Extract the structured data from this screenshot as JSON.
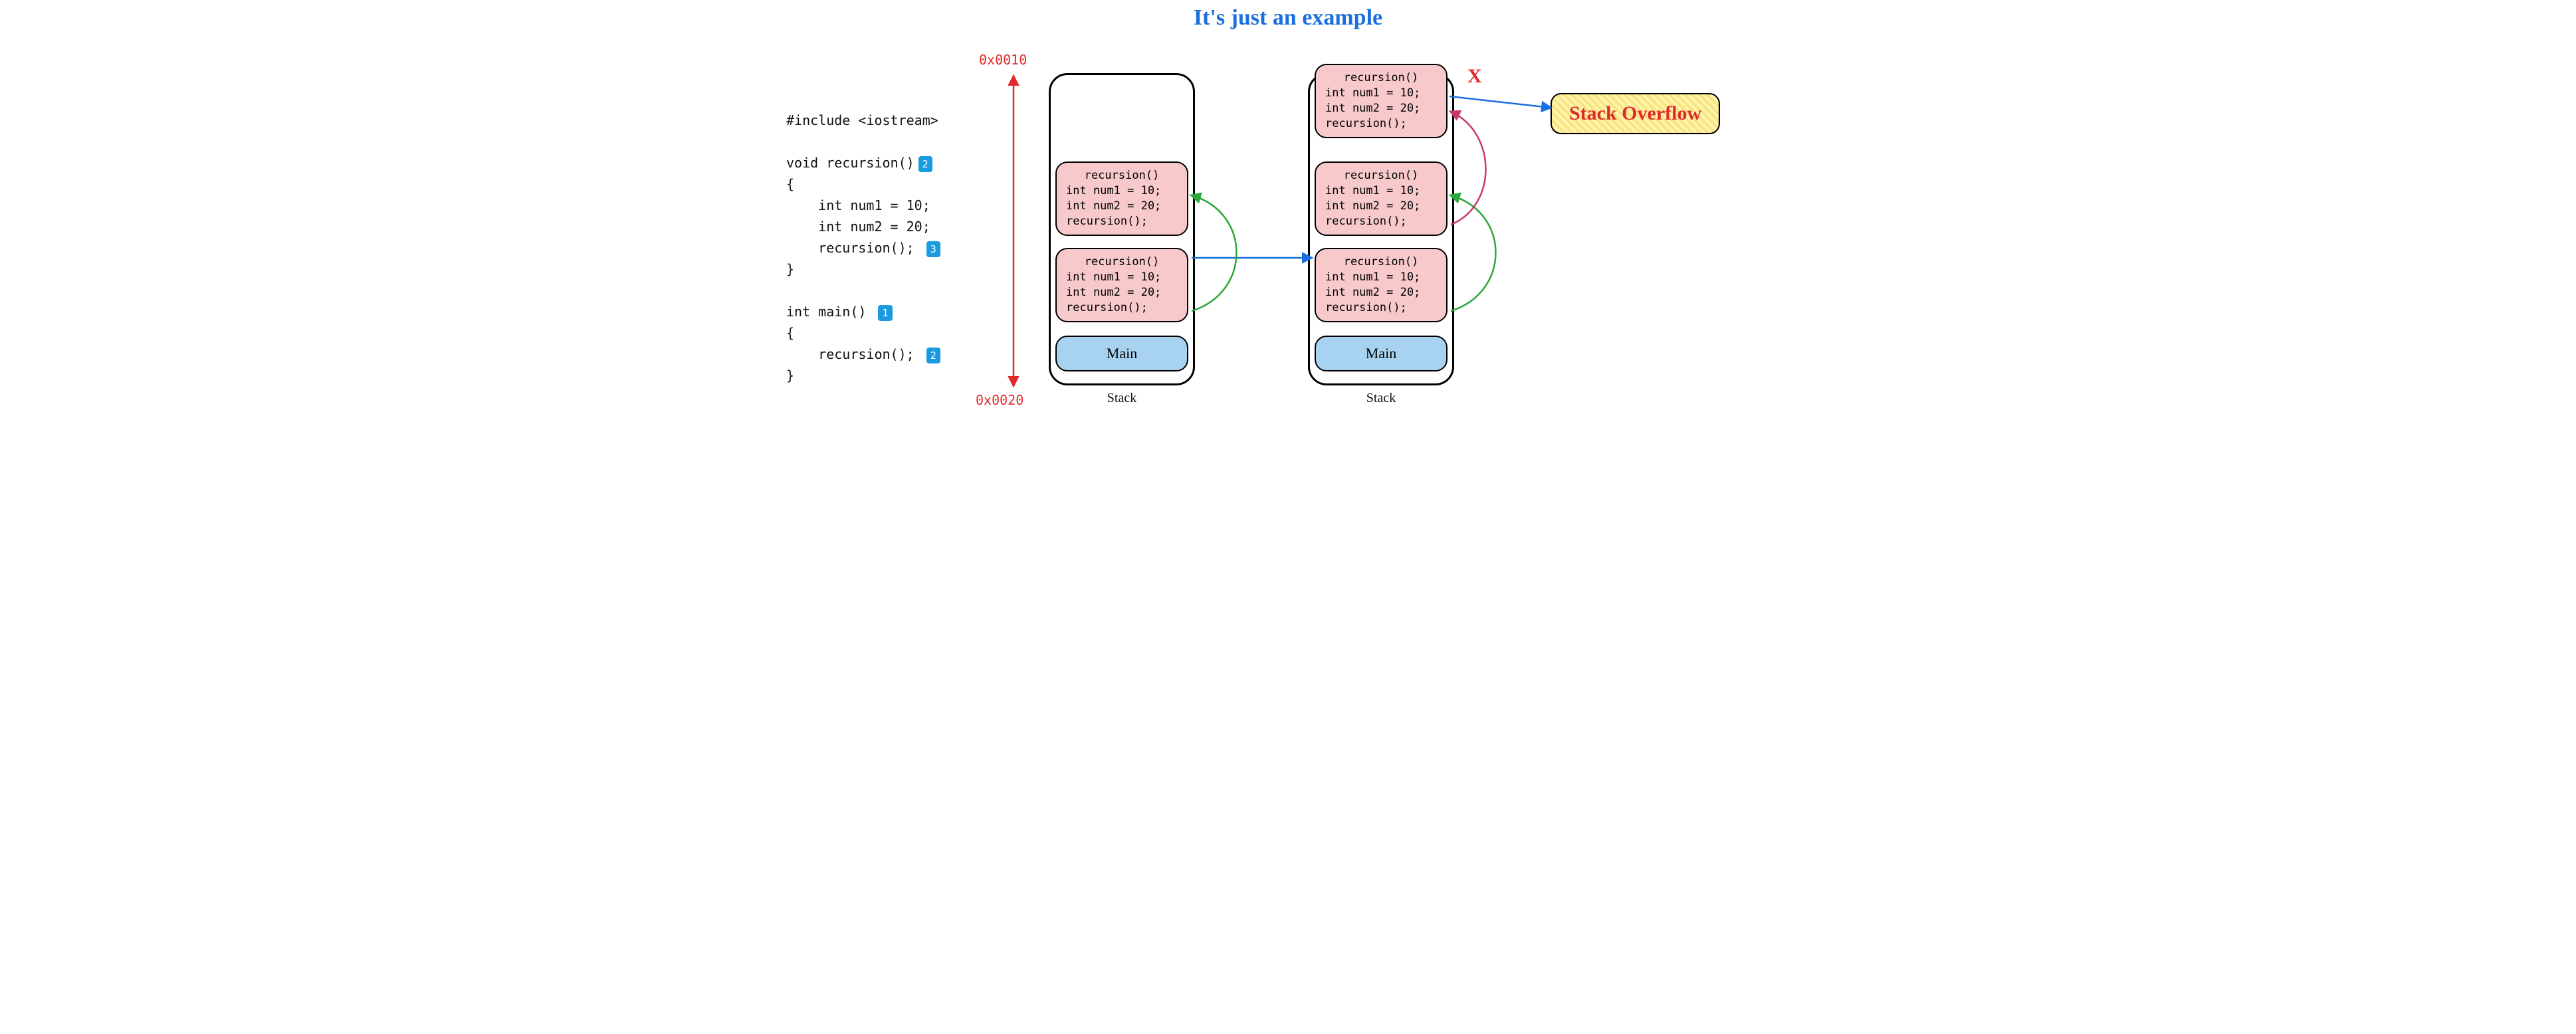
{
  "title": "It's just an example",
  "addresses": {
    "top": "0x0010",
    "bottom": "0x0020"
  },
  "code": {
    "include": "#include <iostream>",
    "fn_decl": "void recursion()",
    "brace_open": "{",
    "body1": "    int num1 = 10;",
    "body2": "    int num2 = 20;",
    "body3_text": "    recursion();",
    "brace_close": "}",
    "main_decl": "int main()",
    "main_open": "{",
    "main_call_text": "    recursion();",
    "main_close": "}",
    "badge1": "1",
    "badge2a": "2",
    "badge2b": "2",
    "badge3": "3"
  },
  "frame": {
    "title": "recursion()",
    "l1": "int num1 = 10;",
    "l2": "int num2 = 20;",
    "l3": "recursion();"
  },
  "main_label": "Main",
  "stack_label": "Stack",
  "overflow_text": "Stack Overflow",
  "xmark": "X",
  "colors": {
    "red": "#e02a2a",
    "green": "#2aa83a",
    "blue_arrow": "#1a6fe0",
    "magenta": "#c9376b"
  }
}
